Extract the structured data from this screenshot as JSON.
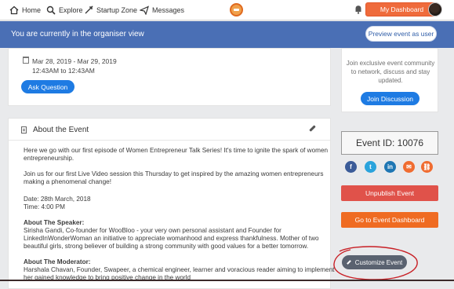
{
  "nav": {
    "home": "Home",
    "explore": "Explore",
    "startup_zone": "Startup Zone",
    "messages": "Messages",
    "my_dashboard": "My Dashboard"
  },
  "banner": {
    "text": "You are currently in the organiser view",
    "preview_label": "Preview event as user"
  },
  "event": {
    "date_range": "Mar 28, 2019 - Mar 29, 2019",
    "time_range": "12:43AM to 12:43AM",
    "ask_question_label": "Ask Question"
  },
  "about": {
    "title": "About the Event",
    "lines": [
      "Here we go with our first episode of Women Entrepreneur Talk Series! It's time to ignite the spark of women",
      "entrepreneurship.",
      "Join us for our first Live Video session this Thursday to get inspired by the amazing women entrepreneurs",
      "making a phenomenal change!",
      "Date: 28th March, 2018",
      "Time: 4:00 PM",
      "About The Speaker:",
      "Sirisha Gandi, Co-founder for WooBloo - your very own personal assistant and Founder for",
      "LinkedInWonderWoman an initiative to appreciate womanhood and express thankfulness. Mother of two",
      "beautiful girls, strong believer of building a strong community with good values for a better tomorrow.",
      "About The Moderator:",
      "Harshala Chavan, Founder, Swapeer, a chemical engineer, learner and voracious reader aiming to implement",
      "her gained knowledge to bring positive change in the world"
    ]
  },
  "sidebar": {
    "community_lines": [
      "Join exclusive event community",
      "to network, discuss and stay",
      "updated."
    ],
    "join_label": "Join Discussion",
    "event_id": "Event ID: 10076",
    "unpublish_label": "Unpublish Event",
    "dashboard_label": "Go to Event Dashboard",
    "customize_label": "Customize Event"
  },
  "social": {
    "facebook": "f",
    "twitter": "t",
    "linkedin": "in",
    "email": "✉",
    "link": "⛓"
  },
  "colors": {
    "banner": "#4a6fb5",
    "primary_blue": "#1e7be3",
    "orange": "#ef6b3c",
    "red": "#e0524a",
    "annotation": "#c81e24"
  }
}
